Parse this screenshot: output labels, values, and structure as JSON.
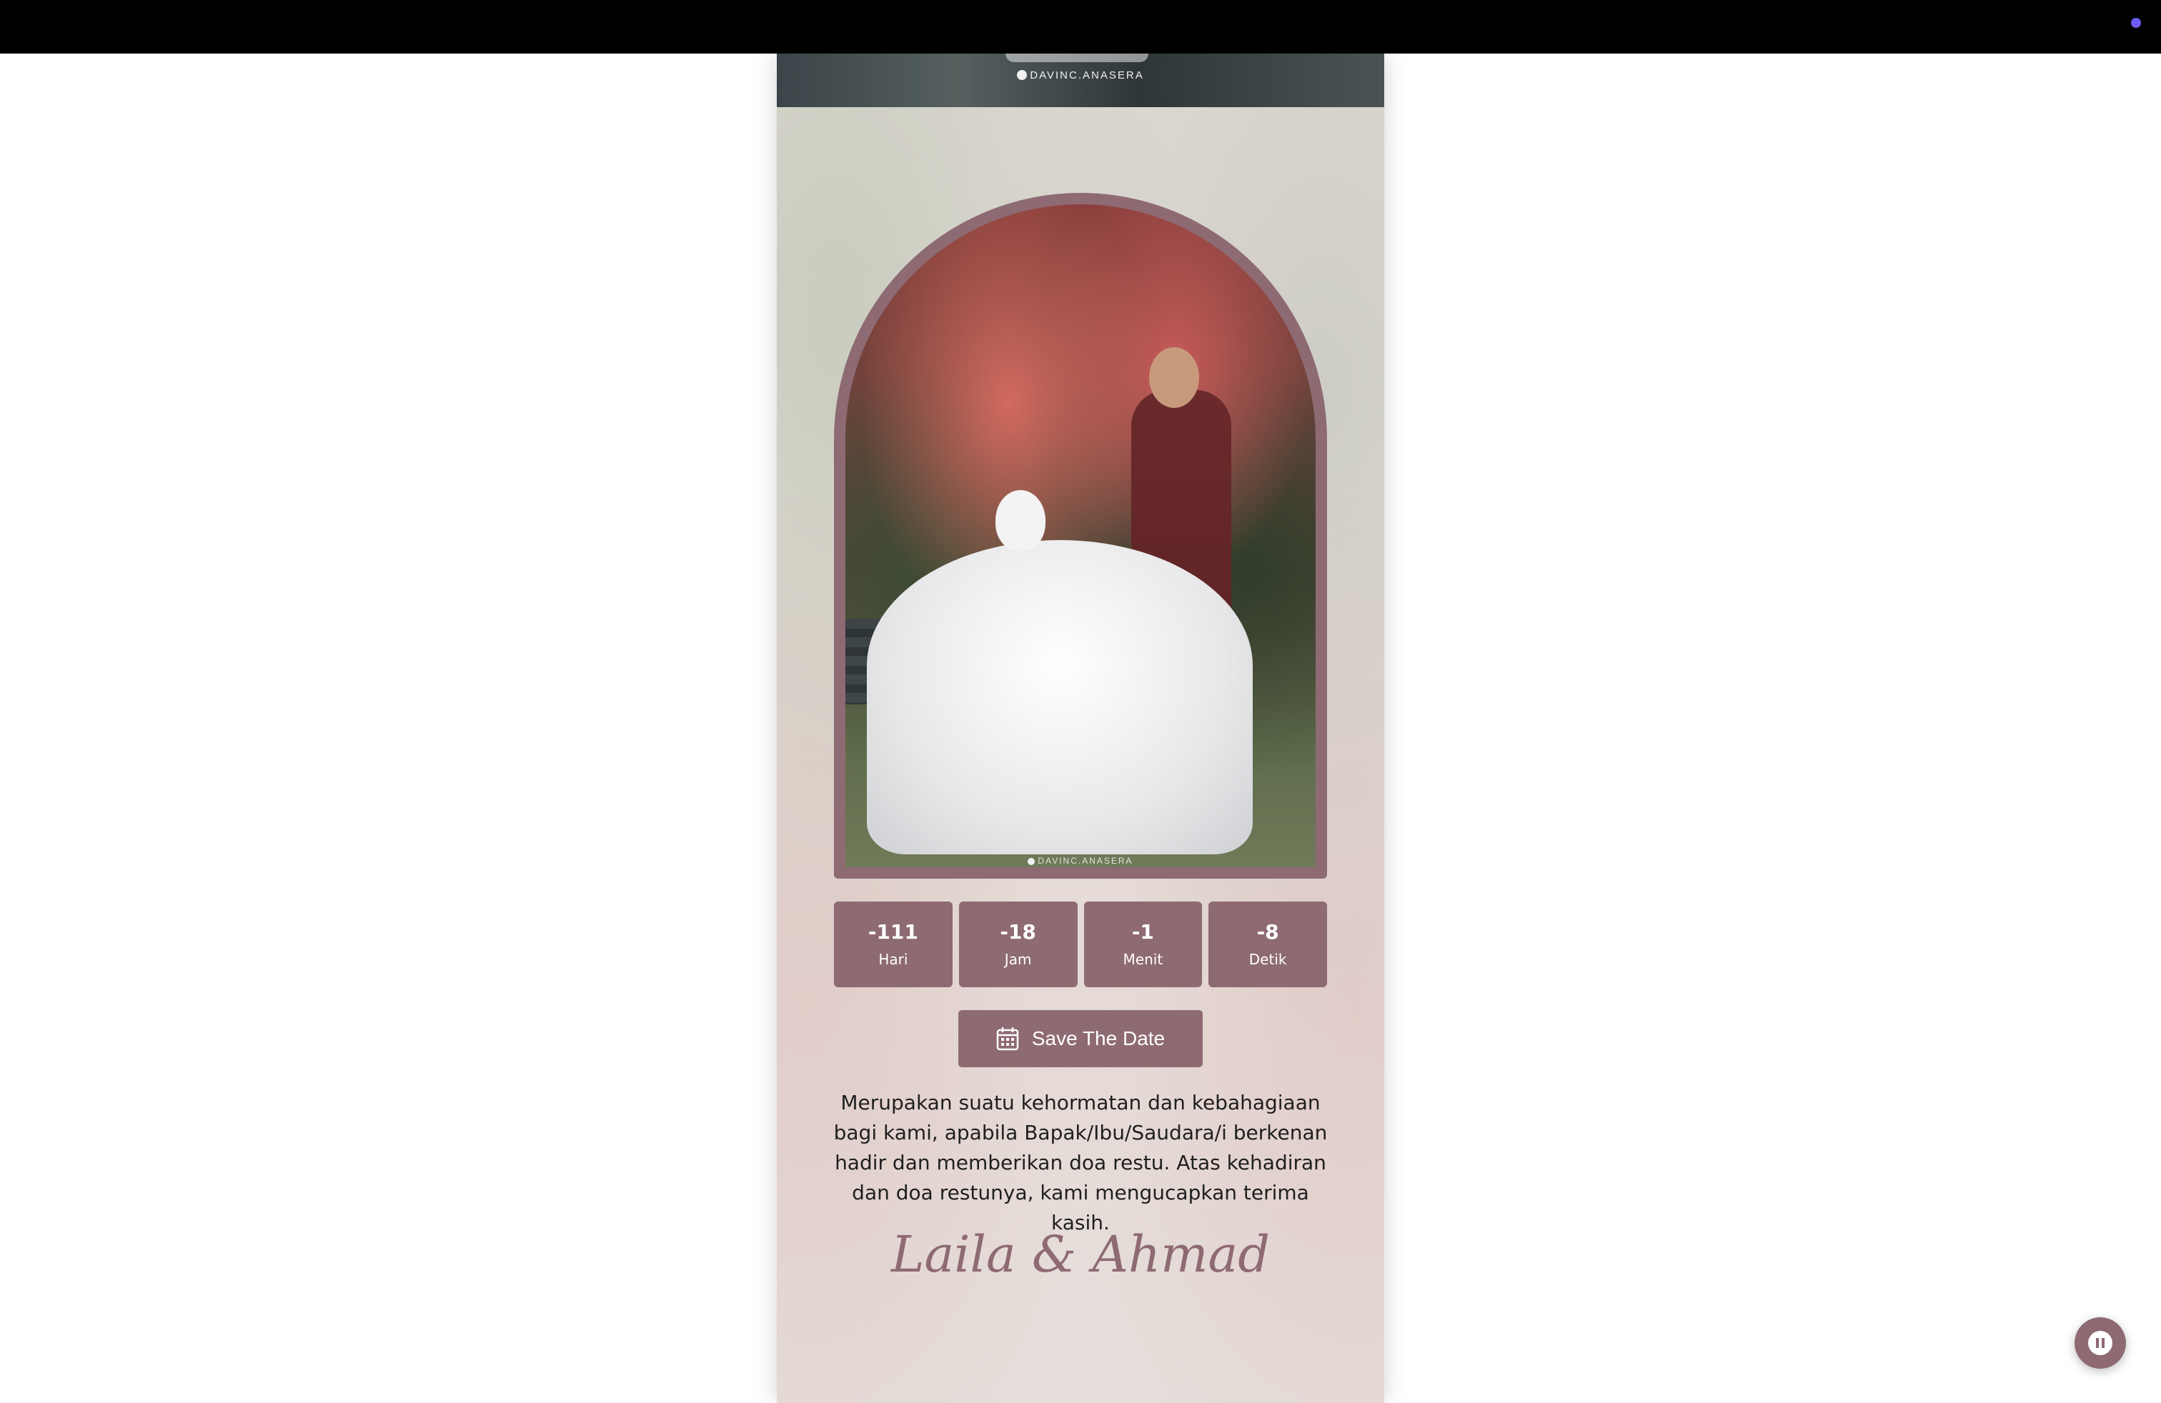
{
  "header": {
    "photo_credit": "DAVINC.ANASERA"
  },
  "photo": {
    "credit": "DAVINC.ANASERA"
  },
  "countdown": {
    "days": {
      "value": "-111",
      "label": "Hari"
    },
    "hours": {
      "value": "-18",
      "label": "Jam"
    },
    "minutes": {
      "value": "-1",
      "label": "Menit"
    },
    "seconds": {
      "value": "-8",
      "label": "Detik"
    }
  },
  "save_button": {
    "label": "Save The Date",
    "icon": "calendar-icon"
  },
  "message": {
    "text": "Merupakan suatu kehormatan dan kebahagiaan bagi kami, apabila Bapak/Ibu/Saudara/i berkenan hadir dan memberikan doa restu. Atas kehadiran dan doa restunya, kami mengucapkan terima kasih."
  },
  "couple": {
    "names": "Laila & Ahmad"
  },
  "music_button": {
    "icon": "music-disc-pause-icon"
  },
  "colors": {
    "accent": "#8e6a73",
    "topbar": "#000000",
    "indicator": "#6b5cf6"
  }
}
